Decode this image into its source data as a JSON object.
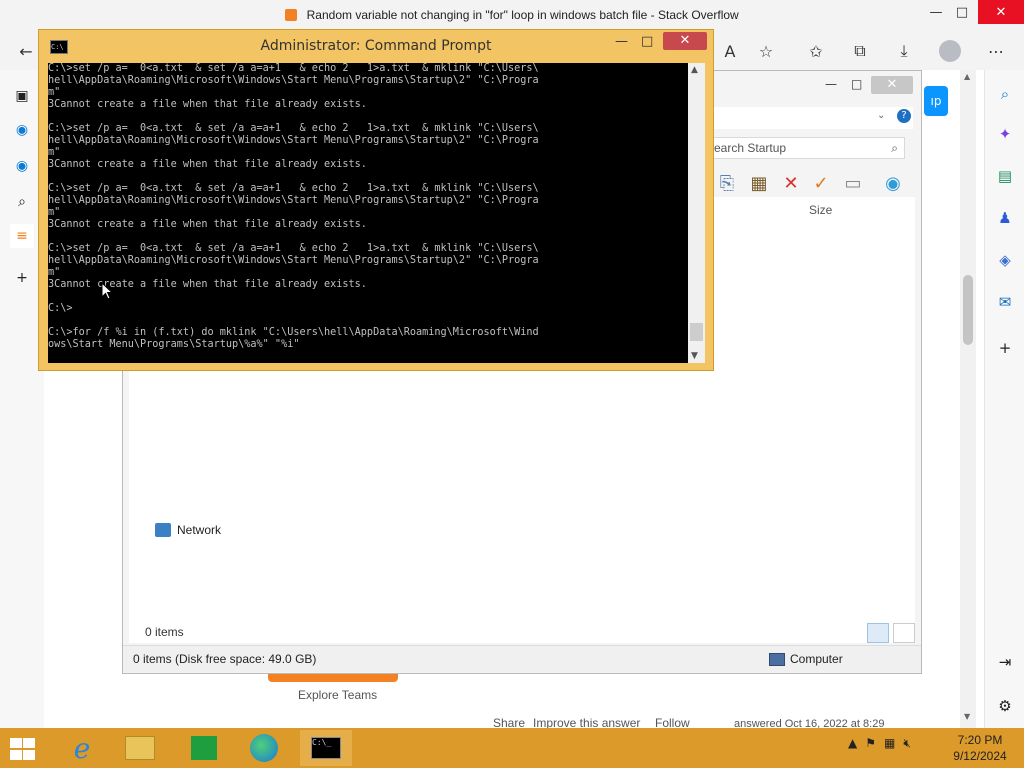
{
  "browser": {
    "title": "Random variable not changing in \"for\" loop in windows batch file - Stack Overflow",
    "window_controls": [
      "—",
      "□",
      "✕"
    ],
    "blue_button_label": "ıp"
  },
  "so_page": {
    "explore_teams": "Explore Teams",
    "footer_links": [
      "Share",
      "Improve this answer",
      "Follow"
    ],
    "answered": "answered Oct 16, 2022 at 8:29"
  },
  "explorer": {
    "search_placeholder": "earch Startup",
    "column_size": "Size",
    "network_label": "Network",
    "items_count": "0 items",
    "status_left": "0 items (Disk free space: 49.0 GB)",
    "status_right": "Computer"
  },
  "cmd": {
    "title": "Administrator: Command Prompt",
    "console_text": "C:\\>set /p a=  0<a.txt  & set /a a=a+1   & echo 2   1>a.txt  & mklink \"C:\\Users\\\nhell\\AppData\\Roaming\\Microsoft\\Windows\\Start Menu\\Programs\\Startup\\2\" \"C:\\Progra\nm\"\n3Cannot create a file when that file already exists.\n\nC:\\>set /p a=  0<a.txt  & set /a a=a+1   & echo 2   1>a.txt  & mklink \"C:\\Users\\\nhell\\AppData\\Roaming\\Microsoft\\Windows\\Start Menu\\Programs\\Startup\\2\" \"C:\\Progra\nm\"\n3Cannot create a file when that file already exists.\n\nC:\\>set /p a=  0<a.txt  & set /a a=a+1   & echo 2   1>a.txt  & mklink \"C:\\Users\\\nhell\\AppData\\Roaming\\Microsoft\\Windows\\Start Menu\\Programs\\Startup\\2\" \"C:\\Progra\nm\"\n3Cannot create a file when that file already exists.\n\nC:\\>set /p a=  0<a.txt  & set /a a=a+1   & echo 2   1>a.txt  & mklink \"C:\\Users\\\nhell\\AppData\\Roaming\\Microsoft\\Windows\\Start Menu\\Programs\\Startup\\2\" \"C:\\Progra\nm\"\n3Cannot create a file when that file already exists.\n\nC:\\>\n\nC:\\>for /f %i in (f.txt) do mklink \"C:\\Users\\hell\\AppData\\Roaming\\Microsoft\\Wind\nows\\Start Menu\\Programs\\Startup\\%a%\" \"%i\""
  },
  "taskbar": {
    "time": "7:20 PM",
    "date": "9/12/2024",
    "apps": [
      "internet-explorer-icon",
      "file-explorer-icon",
      "store-icon",
      "edge-icon",
      "command-prompt-icon"
    ]
  },
  "colors": {
    "taskbar": "#dc9a2a",
    "cmd_frame": "#f3c463",
    "so_orange": "#f48225",
    "so_blue": "#0a95ff"
  }
}
